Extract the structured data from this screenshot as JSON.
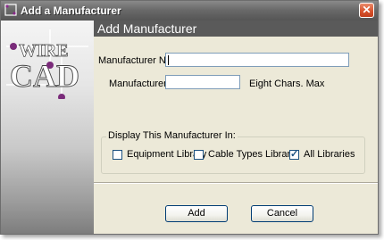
{
  "window": {
    "title": "Add a Manufacturer",
    "close_glyph": "✕",
    "icons": {
      "app": "wirecad-app-icon",
      "close": "close-icon"
    }
  },
  "logo": {
    "line1": "WIRE",
    "line2": "CAD"
  },
  "header": {
    "title": "Add Manufacturer"
  },
  "form": {
    "manufacturer_name": {
      "label": "Manufacturer Name:",
      "value": ""
    },
    "manufacturer_id": {
      "label": "Manufacturer ID:",
      "value": "",
      "hint": "Eight Chars. Max"
    },
    "display_group": {
      "legend": "Display This Manufacturer In:",
      "options": [
        {
          "label": "Equipment Library",
          "checked": false
        },
        {
          "label": "Cable Types Library",
          "checked": false
        },
        {
          "label": "All Libraries",
          "checked": true
        }
      ]
    }
  },
  "buttons": {
    "add_label": "Add",
    "cancel_label": "Cancel"
  },
  "colors": {
    "header_band": "#5a5a5a",
    "dialog_bg": "#ece9d8",
    "button_border": "#003c74"
  }
}
